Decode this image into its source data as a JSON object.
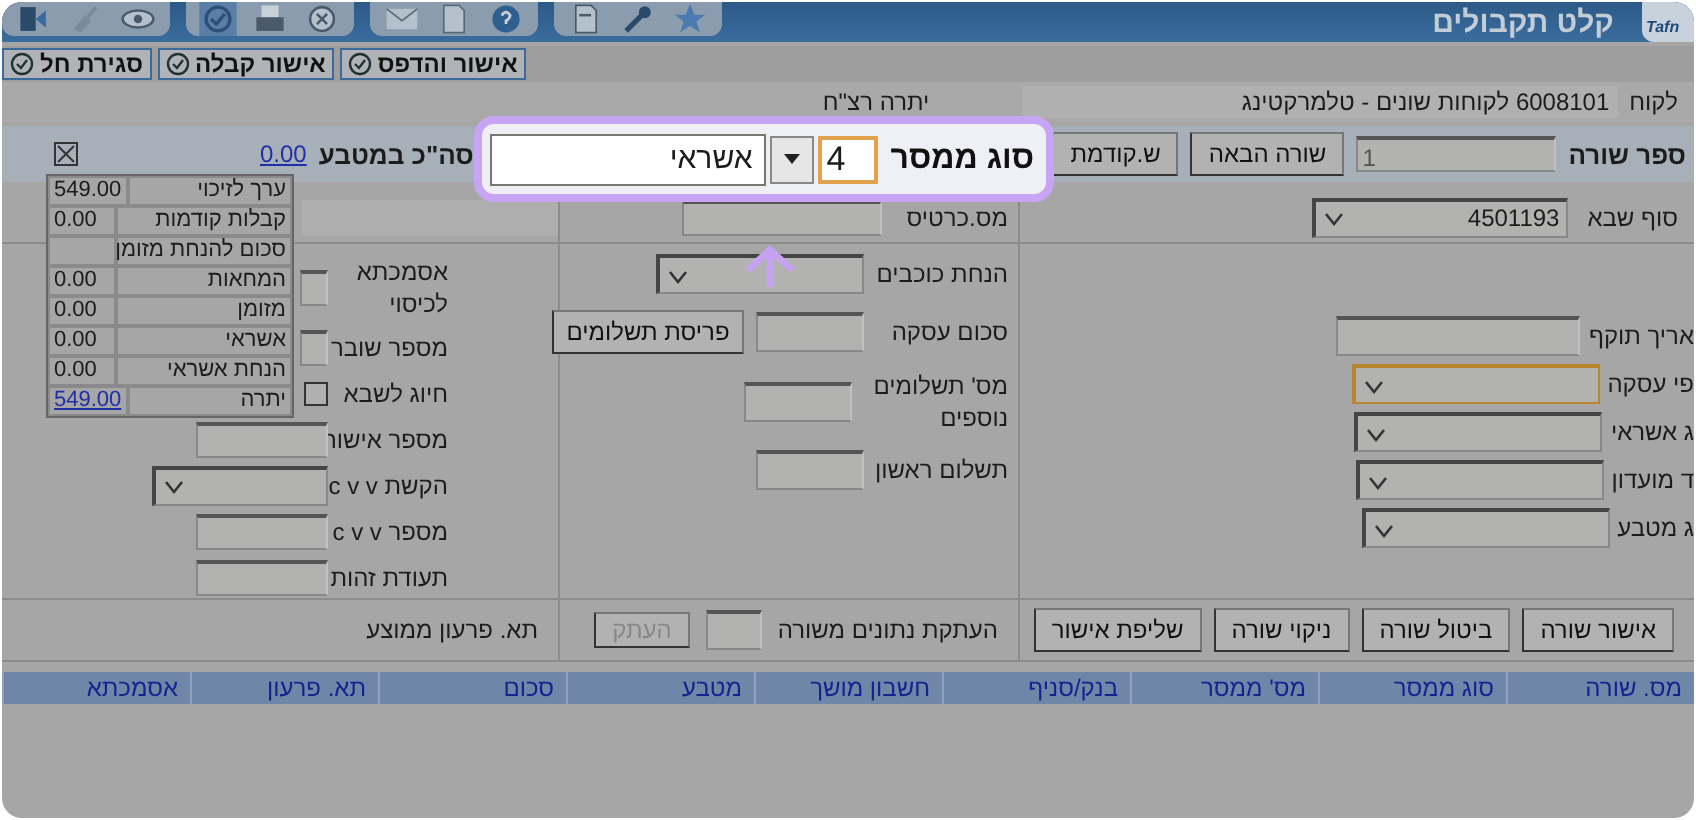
{
  "window": {
    "title": "קלט תקבולים",
    "logo": "Tafn"
  },
  "actions": [
    {
      "label": "אישור והדפס"
    },
    {
      "label": "אישור קבלה"
    },
    {
      "label": "סגירת חל"
    }
  ],
  "customer": {
    "label": "לקוח",
    "value": "6008101 לקוחות שונים - טלמרקטינג",
    "balance_label": "יתרה רצ\"ח"
  },
  "line_bar": {
    "label": "ספר שורה",
    "line_number": "1",
    "buttons": [
      "שורה הבאה",
      "ש.קודמת"
    ],
    "total_label": "סה\"כ במטבע",
    "total": "0.00"
  },
  "callout": {
    "label": "סוג ממסר",
    "code": "4",
    "type": "אשראי"
  },
  "summary": [
    {
      "label": "ערך לזיכוי",
      "value": "549.00",
      "link": false
    },
    {
      "label": "קבלות קודמות",
      "value": "0.00",
      "link": false
    },
    {
      "label": "סכום להנחת מזומן"
    },
    {
      "label": "המחאות",
      "value": "0.00",
      "link": false
    },
    {
      "label": "מזומן",
      "value": "0.00",
      "link": false
    },
    {
      "label": "אשראי",
      "value": "0.00",
      "link": false
    },
    {
      "label": "הנחת אשראי",
      "value": "0.00",
      "link": false
    },
    {
      "label": "יתרה",
      "value": "549.00",
      "link": true
    }
  ],
  "top_fields": [
    {
      "label": "סוף שבא",
      "kind": "select",
      "value": "4501193"
    },
    {
      "label": "מס.כרטיס",
      "kind": "input"
    }
  ],
  "right_fields": [
    {
      "label": "אריך תוקף",
      "kind": "input",
      "focused": false
    },
    {
      "label": "פי עסקה",
      "kind": "select",
      "focused": true
    },
    {
      "label": "ג אשראי",
      "kind": "select",
      "focused": false
    },
    {
      "label": "ד מועדון",
      "kind": "select",
      "focused": false
    },
    {
      "label": "ג מטבע",
      "kind": "select",
      "focused": false
    }
  ],
  "middle_fields": [
    {
      "label": "הנחת כוכבים",
      "kind": "select"
    },
    {
      "label": "סכום עסקה",
      "kind": "input",
      "button": "פריסת תשלומים"
    },
    {
      "label": "מס' תשלומים נוספים",
      "kind": "input"
    },
    {
      "label": "תשלום ראשון",
      "kind": "input"
    }
  ],
  "left_fields": [
    {
      "label": "אסמכתא לכיסוי",
      "kind": "input"
    },
    {
      "label": "מספר שובר",
      "kind": "input"
    },
    {
      "label": "חיוג לשבא",
      "kind": "checkbox",
      "checked": false
    },
    {
      "label": "מספר אישור",
      "kind": "input"
    },
    {
      "label": "הקשת c v v",
      "kind": "select"
    },
    {
      "label": "מספר c v v",
      "kind": "input"
    },
    {
      "label": "תעודת זהות",
      "kind": "input"
    }
  ],
  "row_buttons": [
    {
      "label": "אישור שורה"
    },
    {
      "label": "ביטול שורה"
    },
    {
      "label": "ניקוי שורה"
    },
    {
      "label": "שליפת אישור"
    }
  ],
  "copy": {
    "label": "העתקת נתונים משורה",
    "button": "העתק",
    "disabled": true
  },
  "average_label": "תא. פרעון ממוצע",
  "table": {
    "columns": [
      "מס. שורה",
      "סוג ממסר",
      "מס' ממסר",
      "בנק/סניף",
      "חשבון מושך",
      "מטבע",
      "סכום",
      "תא. פרעון",
      "אסמכתא"
    ]
  }
}
